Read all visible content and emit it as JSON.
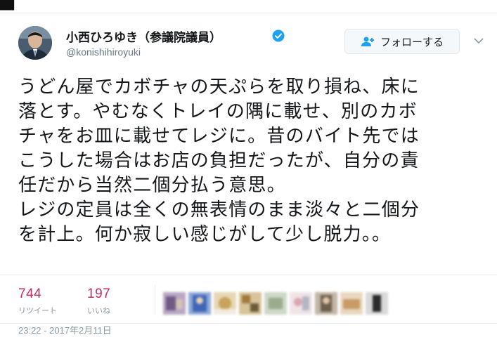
{
  "tweet": {
    "display_name": "小西ひろゆき（参議院議員）",
    "handle": "@konishihiroyuki",
    "follow_label": "フォローする",
    "text": "うどん屋でカボチャの天ぷらを取り損ね、床に\n落とす。やむなくトレイの隅に載せ、別のカボ\nチャをお皿に載せてレジに。昔のバイト先では\nこうした場合はお店の負担だったが、自分の責\n任だから当然二個分払う意思。\nレジの定員は全くの無表情のまま淡々と二個分\nを計上。何か寂しい感じがして少し脱力。。",
    "retweets_count": "744",
    "retweets_label": "リツイート",
    "likes_count": "197",
    "likes_label": "いいね",
    "timestamp": "23:22 - 2017年2月11日"
  },
  "icons": {
    "verified": "verified-badge-icon",
    "follow": "add-user-icon",
    "more": "chevron-down-icon"
  },
  "colors": {
    "accent": "#1da1f2",
    "stat_value": "#c02a6a",
    "muted_text": "#657786"
  }
}
